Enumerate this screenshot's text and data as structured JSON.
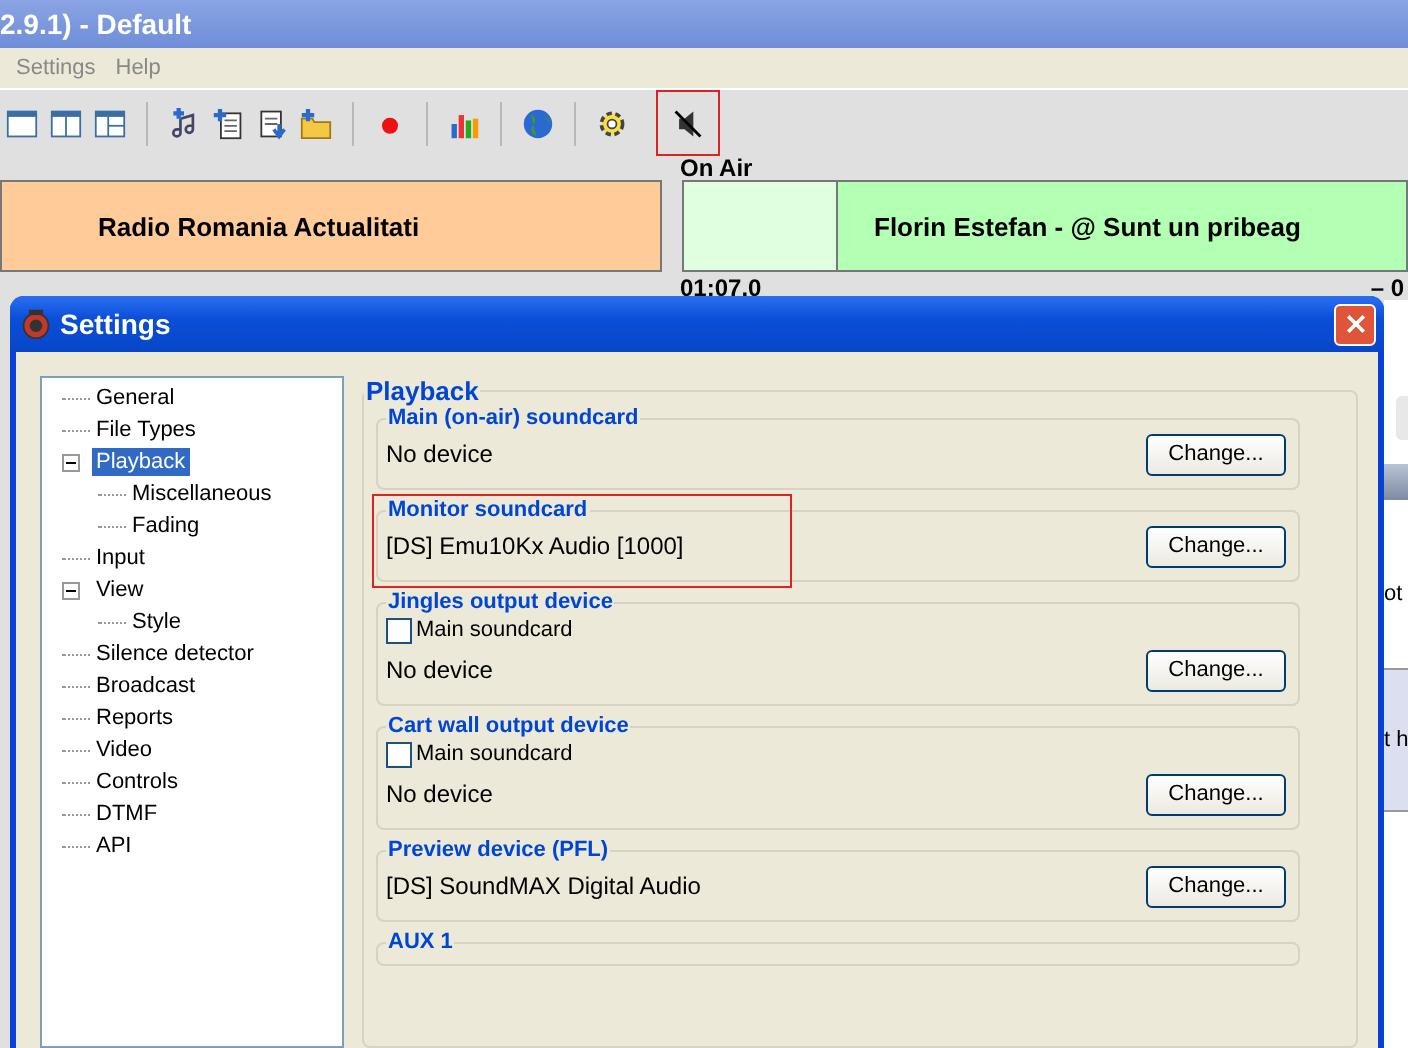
{
  "app_window": {
    "title": "2.9.1) - Default",
    "menu": [
      "Settings",
      "Help"
    ],
    "toolbar_buttons": [
      {
        "highlighted": false
      },
      {
        "highlighted": false
      },
      {
        "highlighted": false
      },
      {
        "highlighted": false
      },
      {
        "highlighted": false
      },
      {
        "highlighted": false
      },
      {
        "highlighted": false
      },
      {
        "highlighted": false
      },
      {
        "highlighted": false
      },
      {
        "highlighted": false
      },
      {
        "highlighted": false
      },
      {
        "highlighted": true
      }
    ],
    "on_air_label": "On Air",
    "players": [
      {
        "text": "Radio Romania Actualitati",
        "color": "#ffcc99"
      },
      {
        "color": "#e0ffe0"
      },
      {
        "text": "Florin Estefan - @ Sunt un pribeag",
        "color": "#b3ffb3"
      }
    ],
    "elapsed": "01:07.0",
    "remaining": "– 0",
    "right_edge_texts": [
      "ot",
      "t h"
    ]
  },
  "settings_dialog": {
    "title": "Settings",
    "tree": [
      {
        "label": "General",
        "selected": false
      },
      {
        "label": "File Types",
        "selected": false
      },
      {
        "label": "Playback",
        "selected": true,
        "expanded": true,
        "children": [
          {
            "label": "Miscellaneous",
            "selected": false
          },
          {
            "label": "Fading",
            "selected": false
          }
        ]
      },
      {
        "label": "Input",
        "selected": false
      },
      {
        "label": "View",
        "selected": false,
        "expanded": true,
        "children": [
          {
            "label": "Style",
            "selected": false
          }
        ]
      },
      {
        "label": "Silence detector",
        "selected": false
      },
      {
        "label": "Broadcast",
        "selected": false
      },
      {
        "label": "Reports",
        "selected": false
      },
      {
        "label": "Video",
        "selected": false
      },
      {
        "label": "Controls",
        "selected": false
      },
      {
        "label": "DTMF",
        "selected": false
      },
      {
        "label": "API",
        "selected": false
      }
    ],
    "section_title": "Playback",
    "groups": [
      {
        "title": "Main (on-air) soundcard",
        "device": "No device",
        "button": "Change...",
        "highlighted": false
      },
      {
        "title": "Monitor soundcard",
        "device": "[DS] Emu10Kx Audio [1000]",
        "button": "Change...",
        "highlighted": true
      },
      {
        "title": "Jingles output device",
        "checkbox": {
          "label": "Main soundcard",
          "checked": false
        },
        "device": "No device",
        "button": "Change...",
        "highlighted": false
      },
      {
        "title": "Cart wall output device",
        "checkbox": {
          "label": "Main soundcard",
          "checked": false
        },
        "device": "No device",
        "button": "Change...",
        "highlighted": false
      },
      {
        "title": "Preview device (PFL)",
        "device": "[DS] SoundMAX Digital Audio",
        "button": "Change...",
        "highlighted": false
      },
      {
        "title": "AUX 1",
        "highlighted": false
      }
    ]
  }
}
